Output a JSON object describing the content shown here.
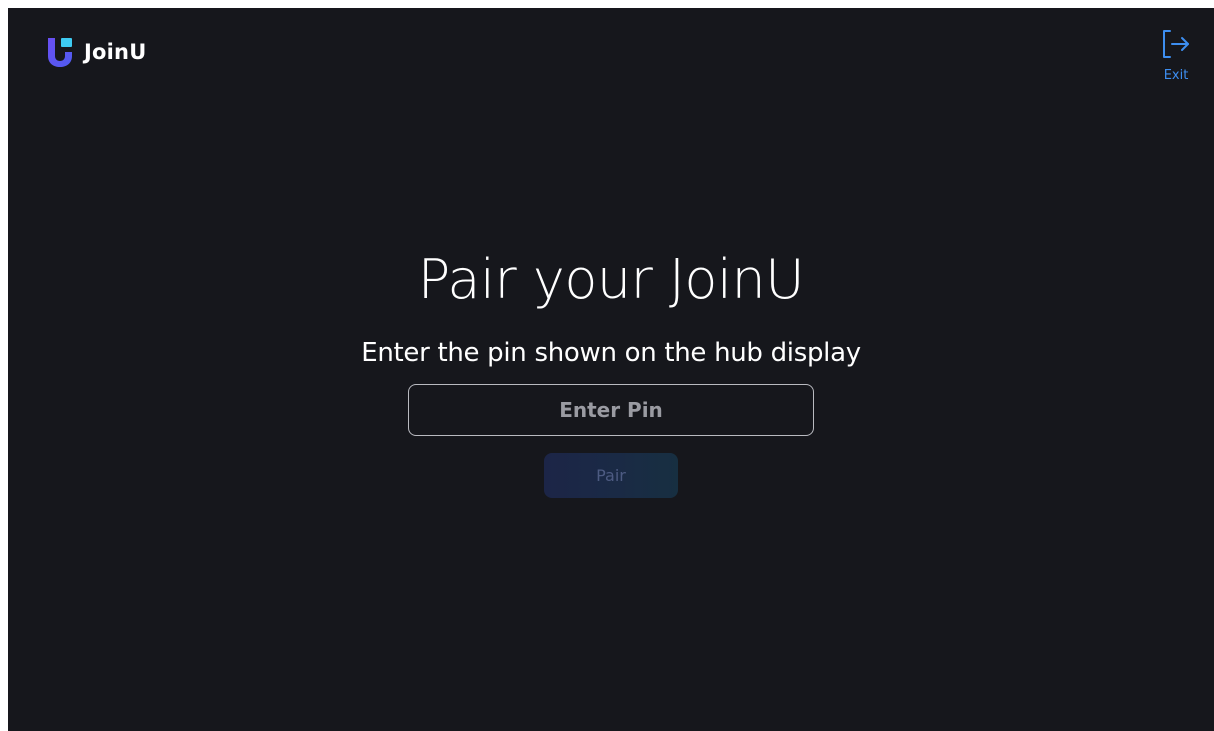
{
  "header": {
    "app_name": "JoinU",
    "logo_icon": "joinu-logo-icon",
    "exit_label": "Exit",
    "exit_icon": "exit-arrow-icon"
  },
  "main": {
    "title": "Pair your JoinU",
    "subtitle": "Enter the pin shown on the hub display",
    "pin_input": {
      "value": "",
      "placeholder": "Enter Pin"
    },
    "pair_button_label": "Pair"
  },
  "colors": {
    "background": "#16171c",
    "accent": "#3d8ef0",
    "logo_primary": "#5b4ef0",
    "logo_secondary": "#35c9f0",
    "button_disabled_text": "#4d5b82"
  }
}
